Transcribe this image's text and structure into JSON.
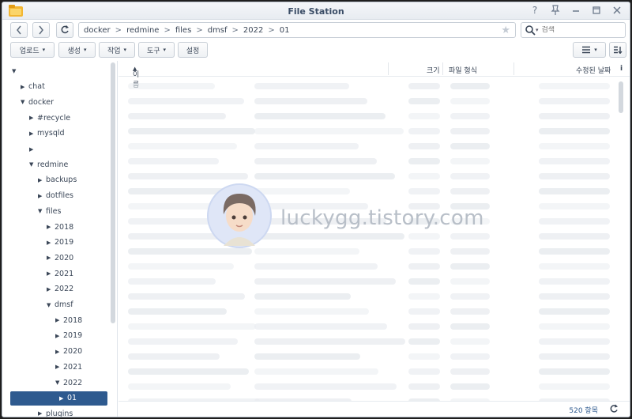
{
  "window": {
    "title": "File Station"
  },
  "nav": {
    "breadcrumb": [
      "docker",
      "redmine",
      "files",
      "dmsf",
      "2022",
      "01"
    ],
    "search_placeholder": "검색"
  },
  "toolbar": {
    "upload": "업로드",
    "create": "생성",
    "action": "작업",
    "tools": "도구",
    "settings": "설정"
  },
  "tree": [
    {
      "label": "",
      "depth": 0,
      "arrow": "down"
    },
    {
      "label": "chat",
      "depth": 1,
      "arrow": "right"
    },
    {
      "label": "docker",
      "depth": 1,
      "arrow": "down"
    },
    {
      "label": "#recycle",
      "depth": 2,
      "arrow": "right"
    },
    {
      "label": "mysqld",
      "depth": 2,
      "arrow": "right"
    },
    {
      "label": "",
      "depth": 2,
      "arrow": "right"
    },
    {
      "label": "redmine",
      "depth": 2,
      "arrow": "down"
    },
    {
      "label": "backups",
      "depth": 3,
      "arrow": "right"
    },
    {
      "label": "dotfiles",
      "depth": 3,
      "arrow": "right"
    },
    {
      "label": "files",
      "depth": 3,
      "arrow": "down"
    },
    {
      "label": "2018",
      "depth": 4,
      "arrow": "right"
    },
    {
      "label": "2019",
      "depth": 4,
      "arrow": "right"
    },
    {
      "label": "2020",
      "depth": 4,
      "arrow": "right"
    },
    {
      "label": "2021",
      "depth": 4,
      "arrow": "right"
    },
    {
      "label": "2022",
      "depth": 4,
      "arrow": "right"
    },
    {
      "label": "dmsf",
      "depth": 4,
      "arrow": "down"
    },
    {
      "label": "2018",
      "depth": 5,
      "arrow": "right"
    },
    {
      "label": "2019",
      "depth": 5,
      "arrow": "right"
    },
    {
      "label": "2020",
      "depth": 5,
      "arrow": "right"
    },
    {
      "label": "2021",
      "depth": 5,
      "arrow": "right"
    },
    {
      "label": "2022",
      "depth": 5,
      "arrow": "down"
    },
    {
      "label": "01",
      "depth": 6,
      "arrow": "right",
      "selected": true
    },
    {
      "label": "plugins",
      "depth": 3,
      "arrow": "right"
    }
  ],
  "columns": {
    "name": "이름",
    "size": "크기",
    "type": "파일 형식",
    "modified": "수정된 날짜"
  },
  "status": {
    "count": "520 항목"
  },
  "watermark": "luckygg.tistory.com",
  "colors": {
    "accent": "#2e5a8f"
  }
}
